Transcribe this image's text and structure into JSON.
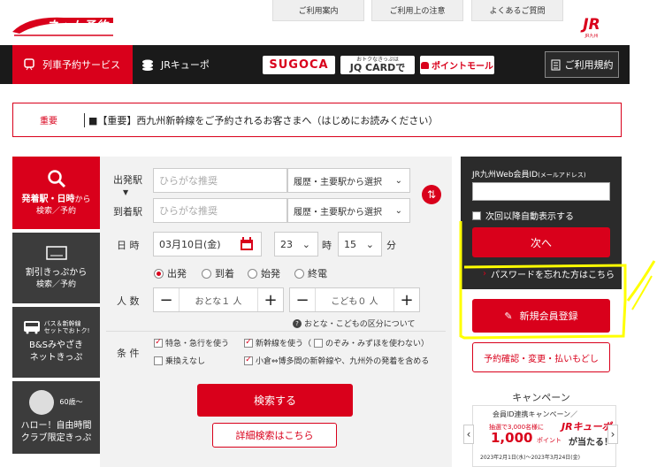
{
  "header": {
    "logo_text": "ネット予約",
    "links": [
      "ご利用案内",
      "ご利用上の注意",
      "よくあるご質問"
    ],
    "jr_logo": "JR",
    "jr_sub": "JR九州"
  },
  "nav": {
    "active_label": "列車予約サービス",
    "jr_kyupo": "JRキューポ",
    "sugoca": "SUGOCA",
    "jqcard_small": "おトクなきっぷは",
    "jqcard": "JQ CARDで",
    "point_mall": "ポイントモール",
    "terms": "ご利用規約",
    "accent_color": "#d9001b"
  },
  "notice": {
    "label": "重要",
    "text": "■【重要】西九州新幹線をご予約されるお客さまへ（はじめにお読みください）"
  },
  "tabs": [
    {
      "line1": "発着駅・日時",
      "line1b": "から",
      "line2": "検索／予約"
    },
    {
      "line1": "割引きっぷから",
      "line2": "検索／予約"
    },
    {
      "small1": "バス＆新幹線",
      "small2": "セットでおトク!",
      "line1": "B&Sみやざき",
      "line2": "ネットきっぷ"
    },
    {
      "badge": "60歳～",
      "line1": "ハロー！自由時間",
      "line2": "クラブ限定きっぷ"
    }
  ],
  "form": {
    "dep_label": "出発駅",
    "arr_label": "到着駅",
    "dep_placeholder": "ひらがな推奨",
    "arr_placeholder": "ひらがな推奨",
    "history_select": "履歴・主要駅から選択",
    "datetime_label": "日 時",
    "date": "03月10日(金)",
    "hour": "23",
    "hour_unit": "時",
    "minute": "15",
    "minute_unit": "分",
    "time_options": [
      "出発",
      "到着",
      "始発",
      "終電"
    ],
    "people_label": "人 数",
    "adult": "おとな１ 人",
    "child": "こども０ 人",
    "age_help": "おとな・こどもの区分について",
    "cond_label": "条 件",
    "cond_express": "特急・急行を使う",
    "cond_shinkansen": "新幹線を使う（",
    "cond_nozomi": "のぞみ・みずほを使わない）",
    "cond_no_transfer": "乗換えなし",
    "cond_kokura": "小倉⇔博多間の新幹線や、九州外の発着を含める",
    "search_button": "検索する",
    "detail_search": "詳細検索はこちら"
  },
  "login": {
    "id_label": "JR九州Web会員ID",
    "id_label_small": "(メールアドレス)",
    "auto_display": "次回以降自動表示する",
    "next_button": "次へ",
    "forgot": "パスワードを忘れた方はこちら",
    "register": "新規会員登録",
    "manage": "予約確認・変更・払いもどし"
  },
  "campaign": {
    "heading": "キャンペーン",
    "title": "会員ID連携キャンペーン／",
    "line2": "抽選で3,000名様に",
    "big_number": "1,000",
    "point_label": "ポイント",
    "kyupo": "JRキューポ",
    "line3": "が当たる！",
    "period": "2023年2月1日(水)～2023年3月24日(金)"
  }
}
